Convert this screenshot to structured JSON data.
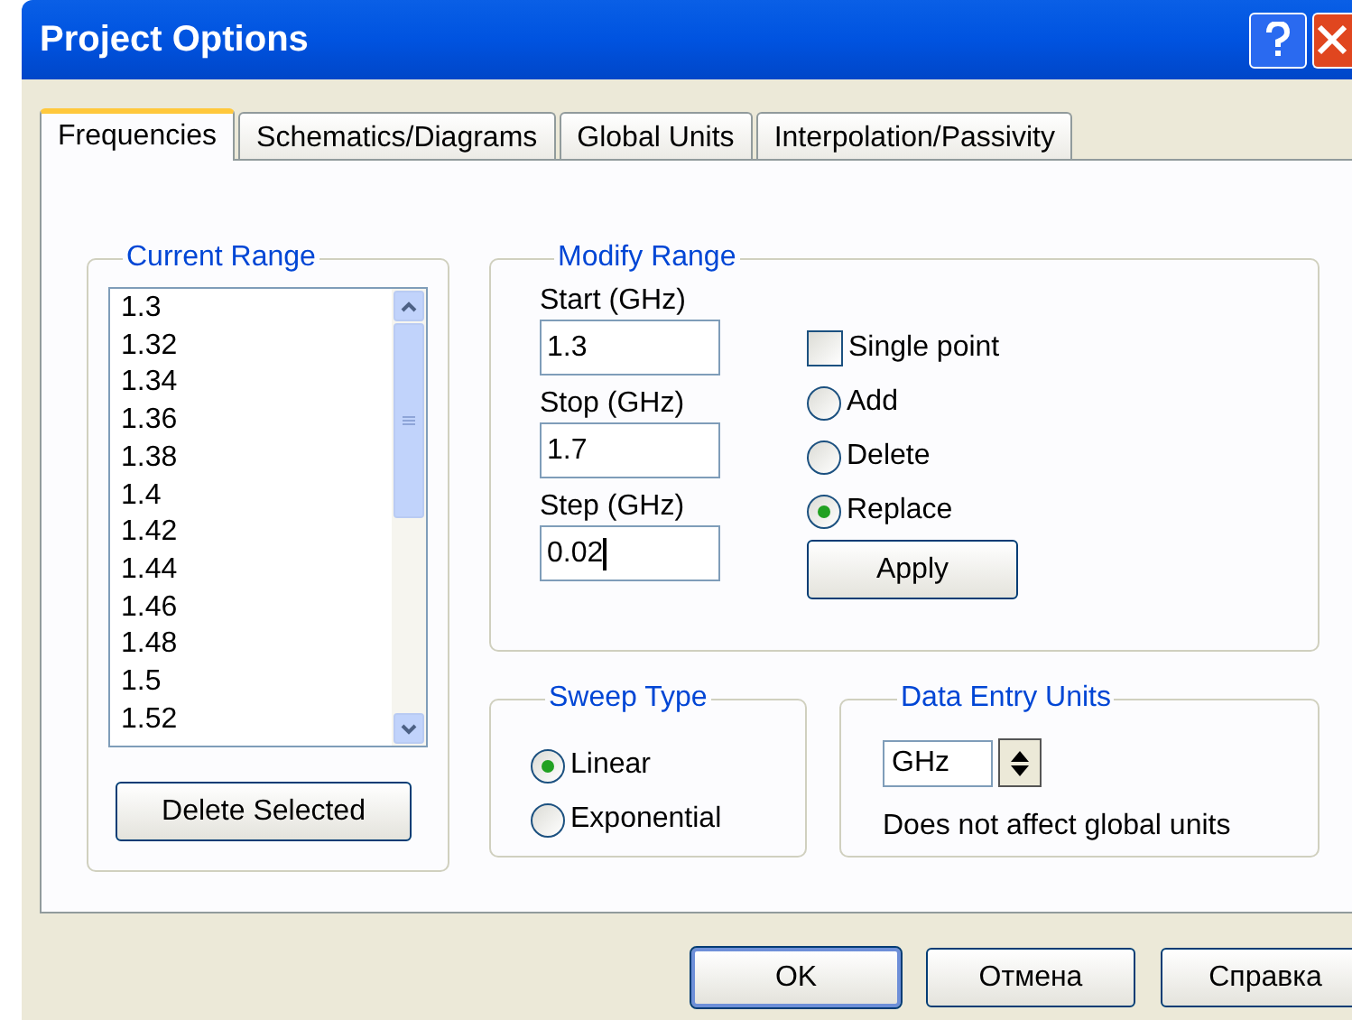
{
  "window": {
    "title": "Project Options"
  },
  "tabs": [
    {
      "label": "Frequencies",
      "selected": true
    },
    {
      "label": "Schematics/Diagrams",
      "selected": false
    },
    {
      "label": "Global Units",
      "selected": false
    },
    {
      "label": "Interpolation/Passivity",
      "selected": false
    }
  ],
  "current_range": {
    "title": "Current Range",
    "items": [
      "1.3",
      "1.32",
      "1.34",
      "1.36",
      "1.38",
      "1.4",
      "1.42",
      "1.44",
      "1.46",
      "1.48",
      "1.5",
      "1.52"
    ],
    "delete_button": "Delete Selected"
  },
  "modify_range": {
    "title": "Modify Range",
    "fields": [
      {
        "label": "Start (GHz)",
        "value": "1.3",
        "focused": false
      },
      {
        "label": "Stop (GHz)",
        "value": "1.7",
        "focused": false
      },
      {
        "label": "Step (GHz)",
        "value": "0.02",
        "focused": true
      }
    ],
    "single_point": {
      "label": "Single point",
      "checked": false
    },
    "actions": [
      {
        "label": "Add",
        "selected": false
      },
      {
        "label": "Delete",
        "selected": false
      },
      {
        "label": "Replace",
        "selected": true
      }
    ],
    "apply_button": "Apply"
  },
  "sweep_type": {
    "title": "Sweep Type",
    "options": [
      {
        "label": "Linear",
        "selected": true
      },
      {
        "label": "Exponential",
        "selected": false
      }
    ]
  },
  "data_entry_units": {
    "title": "Data Entry Units",
    "value": "GHz",
    "note": "Does not affect global units"
  },
  "buttons": [
    {
      "label": "OK",
      "default": true
    },
    {
      "label": "Отмена",
      "default": false
    },
    {
      "label": "Справка",
      "default": false
    }
  ]
}
